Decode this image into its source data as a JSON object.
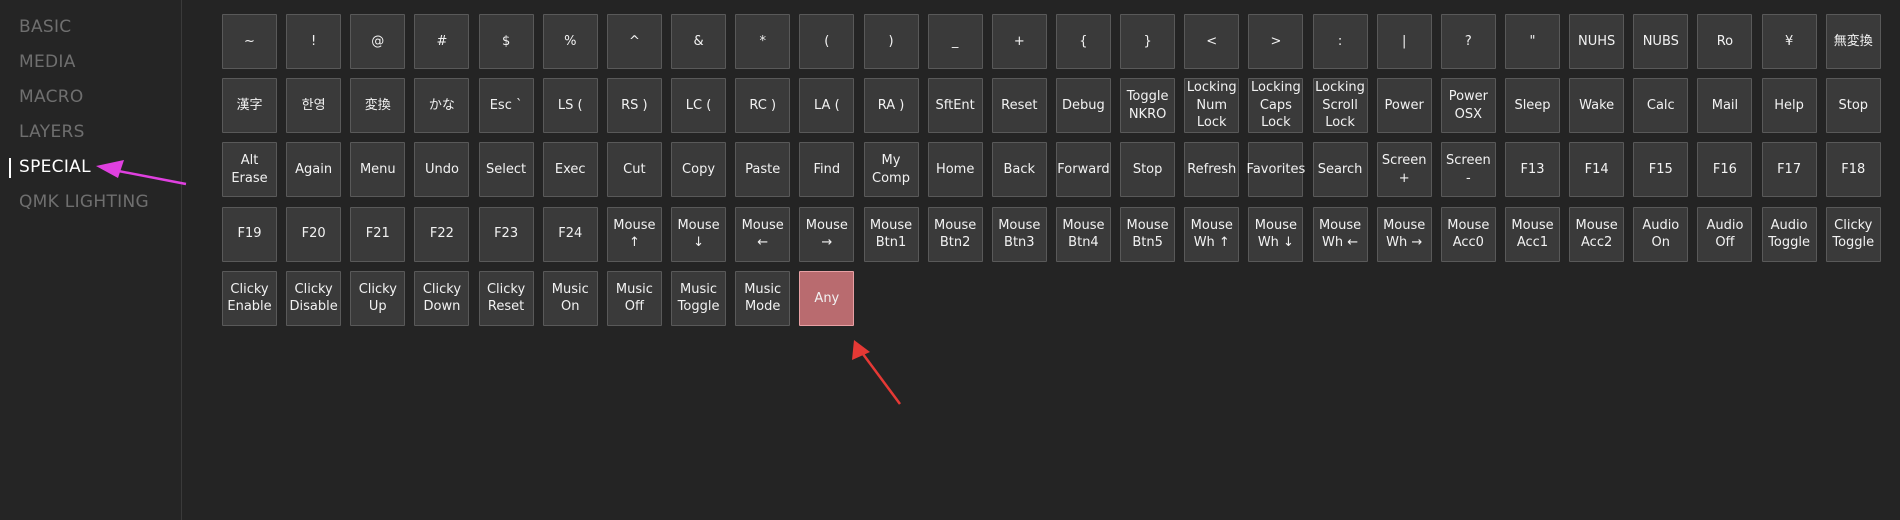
{
  "sidebar": {
    "items": [
      {
        "label": "BASIC"
      },
      {
        "label": "MEDIA"
      },
      {
        "label": "MACRO"
      },
      {
        "label": "LAYERS"
      },
      {
        "label": "SPECIAL"
      },
      {
        "label": "QMK LIGHTING"
      }
    ],
    "active": "SPECIAL"
  },
  "keys": [
    "~",
    "!",
    "@",
    "#",
    "$",
    "%",
    "^",
    "&",
    "*",
    "(",
    ")",
    "_",
    "+",
    "{",
    "}",
    "<",
    ">",
    ":",
    "|",
    "?",
    "\"",
    "NUHS",
    "NUBS",
    "Ro",
    "¥",
    "無変換",
    "漢字",
    "한영",
    "変換",
    "かな",
    "Esc `",
    "LS (",
    "RS )",
    "LC (",
    "RC )",
    "LA (",
    "RA )",
    "SftEnt",
    "Reset",
    "Debug",
    "Toggle\nNKRO",
    "Locking\nNum\nLock",
    "Locking\nCaps\nLock",
    "Locking\nScroll\nLock",
    "Power",
    "Power\nOSX",
    "Sleep",
    "Wake",
    "Calc",
    "Mail",
    "Help",
    "Stop",
    "Alt\nErase",
    "Again",
    "Menu",
    "Undo",
    "Select",
    "Exec",
    "Cut",
    "Copy",
    "Paste",
    "Find",
    "My\nComp",
    "Home",
    "Back",
    "Forward",
    "Stop",
    "Refresh",
    "Favorites",
    "Search",
    "Screen +",
    "Screen -",
    "F13",
    "F14",
    "F15",
    "F16",
    "F17",
    "F18",
    "F19",
    "F20",
    "F21",
    "F22",
    "F23",
    "F24",
    "Mouse ↑",
    "Mouse ↓",
    "Mouse\n←",
    "Mouse\n→",
    "Mouse\nBtn1",
    "Mouse\nBtn2",
    "Mouse\nBtn3",
    "Mouse\nBtn4",
    "Mouse\nBtn5",
    "Mouse\nWh ↑",
    "Mouse\nWh ↓",
    "Mouse\nWh ←",
    "Mouse\nWh →",
    "Mouse\nAcc0",
    "Mouse\nAcc1",
    "Mouse\nAcc2",
    "Audio\nOn",
    "Audio\nOff",
    "Audio\nToggle",
    "Clicky\nToggle",
    "Clicky\nEnable",
    "Clicky\nDisable",
    "Clicky\nUp",
    "Clicky\nDown",
    "Clicky\nReset",
    "Music\nOn",
    "Music\nOff",
    "Music\nToggle",
    "Music\nMode",
    "Any"
  ],
  "highlighted_key": "Any",
  "colors": {
    "background": "#242424",
    "key_bg": "#3a3a3a",
    "key_border": "#595959",
    "highlight_bg": "#b96b6f",
    "active_text": "#ffffff",
    "inactive_text": "#6f6f6f",
    "sidebar_arrow": "#e040e0",
    "key_arrow": "#e53935"
  }
}
